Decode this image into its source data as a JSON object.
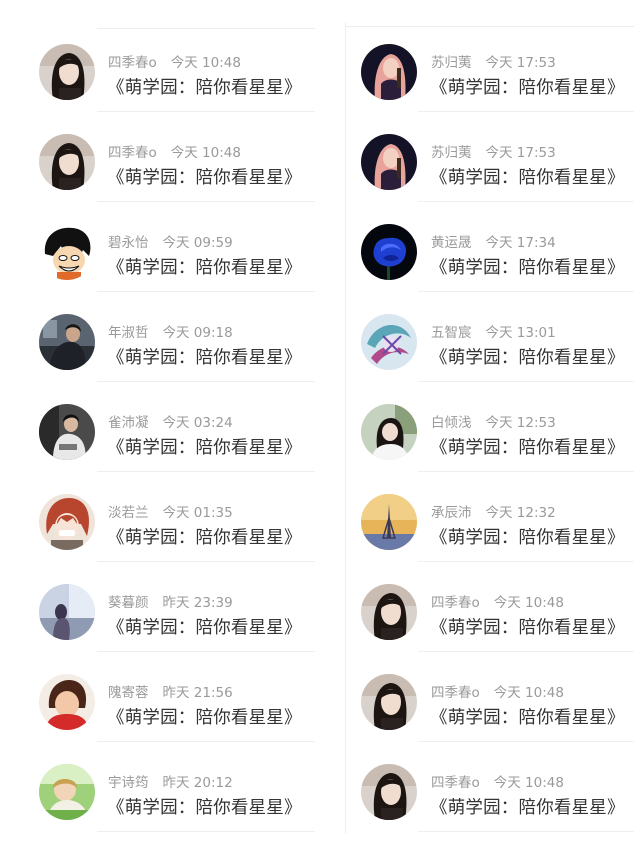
{
  "left_column": [
    {
      "name": "四季春o",
      "time": "今天 10:48",
      "message": "《萌学园：陪你看星星》",
      "avatar": "avatar-girl-longhair"
    },
    {
      "name": "四季春o",
      "time": "今天 10:48",
      "message": "《萌学园：陪你看星星》",
      "avatar": "avatar-girl-longhair"
    },
    {
      "name": "碧永怡",
      "time": "今天 09:59",
      "message": "《萌学园：陪你看星星》",
      "avatar": "avatar-cartoon-boy"
    },
    {
      "name": "年淑哲",
      "time": "今天 09:18",
      "message": "《萌学园：陪你看星星》",
      "avatar": "avatar-person-dark"
    },
    {
      "name": "雀沛凝",
      "time": "今天 03:24",
      "message": "《萌学园：陪你看星星》",
      "avatar": "avatar-person-sitting"
    },
    {
      "name": "淡若兰",
      "time": "今天 01:35",
      "message": "《萌学园：陪你看星星》",
      "avatar": "avatar-anime-redhair"
    },
    {
      "name": "葵暮颜",
      "time": "昨天 23:39",
      "message": "《萌学园：陪你看星星》",
      "avatar": "avatar-window-scene"
    },
    {
      "name": "隗寄蓉",
      "time": "昨天 21:56",
      "message": "《萌学园：陪你看星星》",
      "avatar": "avatar-child-red"
    },
    {
      "name": "宇诗筠",
      "time": "昨天 20:12",
      "message": "《萌学园：陪你看星星》",
      "avatar": "avatar-child-grass"
    }
  ],
  "right_column": [
    {
      "name": "苏归荑",
      "time": "今天 17:53",
      "message": "《萌学园：陪你看星星》",
      "avatar": "avatar-girl-dark-stage"
    },
    {
      "name": "苏归荑",
      "time": "今天 17:53",
      "message": "《萌学园：陪你看星星》",
      "avatar": "avatar-girl-dark-stage"
    },
    {
      "name": "黄运晟",
      "time": "今天 17:34",
      "message": "《萌学园：陪你看星星》",
      "avatar": "avatar-blue-rose"
    },
    {
      "name": "五智宸",
      "time": "今天 13:01",
      "message": "《萌学园：陪你看星星》",
      "avatar": "avatar-dragon-art"
    },
    {
      "name": "白倾浅",
      "time": "今天 12:53",
      "message": "《萌学园：陪你看星星》",
      "avatar": "avatar-girl-white"
    },
    {
      "name": "承辰沛",
      "time": "今天 12:32",
      "message": "《萌学园：陪你看星星》",
      "avatar": "avatar-tower-sunset"
    },
    {
      "name": "四季春o",
      "time": "今天 10:48",
      "message": "《萌学园：陪你看星星》",
      "avatar": "avatar-girl-longhair"
    },
    {
      "name": "四季春o",
      "time": "今天 10:48",
      "message": "《萌学园：陪你看星星》",
      "avatar": "avatar-girl-longhair"
    },
    {
      "name": "四季春o",
      "time": "今天 10:48",
      "message": "《萌学园：陪你看星星》",
      "avatar": "avatar-girl-longhair"
    }
  ],
  "colors": {
    "name_text": "#9a9a9a",
    "message_text": "#333333",
    "divider": "#efefef"
  }
}
